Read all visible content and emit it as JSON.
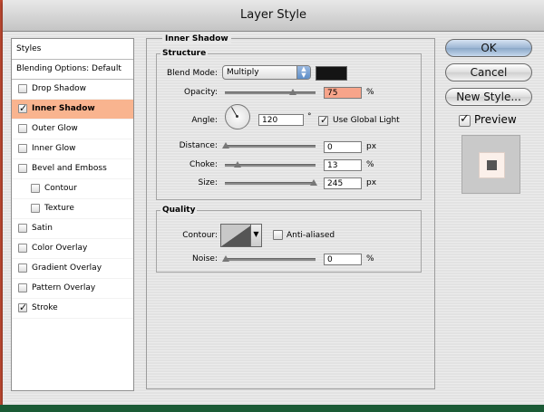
{
  "window": {
    "title": "Layer Style"
  },
  "styles_list": {
    "header": "Styles",
    "blending": "Blending Options: Default",
    "items": [
      {
        "label": "Drop Shadow",
        "checked": false,
        "selected": false,
        "indent": false
      },
      {
        "label": "Inner Shadow",
        "checked": true,
        "selected": true,
        "indent": false
      },
      {
        "label": "Outer Glow",
        "checked": false,
        "selected": false,
        "indent": false
      },
      {
        "label": "Inner Glow",
        "checked": false,
        "selected": false,
        "indent": false
      },
      {
        "label": "Bevel and Emboss",
        "checked": false,
        "selected": false,
        "indent": false
      },
      {
        "label": "Contour",
        "checked": false,
        "selected": false,
        "indent": true
      },
      {
        "label": "Texture",
        "checked": false,
        "selected": false,
        "indent": true
      },
      {
        "label": "Satin",
        "checked": false,
        "selected": false,
        "indent": false
      },
      {
        "label": "Color Overlay",
        "checked": false,
        "selected": false,
        "indent": false
      },
      {
        "label": "Gradient Overlay",
        "checked": false,
        "selected": false,
        "indent": false
      },
      {
        "label": "Pattern Overlay",
        "checked": false,
        "selected": false,
        "indent": false
      },
      {
        "label": "Stroke",
        "checked": true,
        "selected": false,
        "indent": false
      }
    ]
  },
  "inner_shadow": {
    "title": "Inner Shadow",
    "structure": {
      "title": "Structure",
      "blend_mode_label": "Blend Mode:",
      "blend_mode_value": "Multiply",
      "blend_color": "#141414",
      "opacity_label": "Opacity:",
      "opacity_value": "75",
      "opacity_unit": "%",
      "angle_label": "Angle:",
      "angle_value": "120",
      "angle_unit": "°",
      "use_global_light_label": "Use Global Light",
      "use_global_light": true,
      "distance_label": "Distance:",
      "distance_value": "0",
      "distance_unit": "px",
      "choke_label": "Choke:",
      "choke_value": "13",
      "choke_unit": "%",
      "size_label": "Size:",
      "size_value": "245",
      "size_unit": "px"
    },
    "quality": {
      "title": "Quality",
      "contour_label": "Contour:",
      "anti_aliased_label": "Anti-aliased",
      "anti_aliased": false,
      "noise_label": "Noise:",
      "noise_value": "0",
      "noise_unit": "%"
    }
  },
  "buttons": {
    "ok": "OK",
    "cancel": "Cancel",
    "new_style": "New Style..."
  },
  "preview": {
    "label": "Preview",
    "checked": true
  }
}
